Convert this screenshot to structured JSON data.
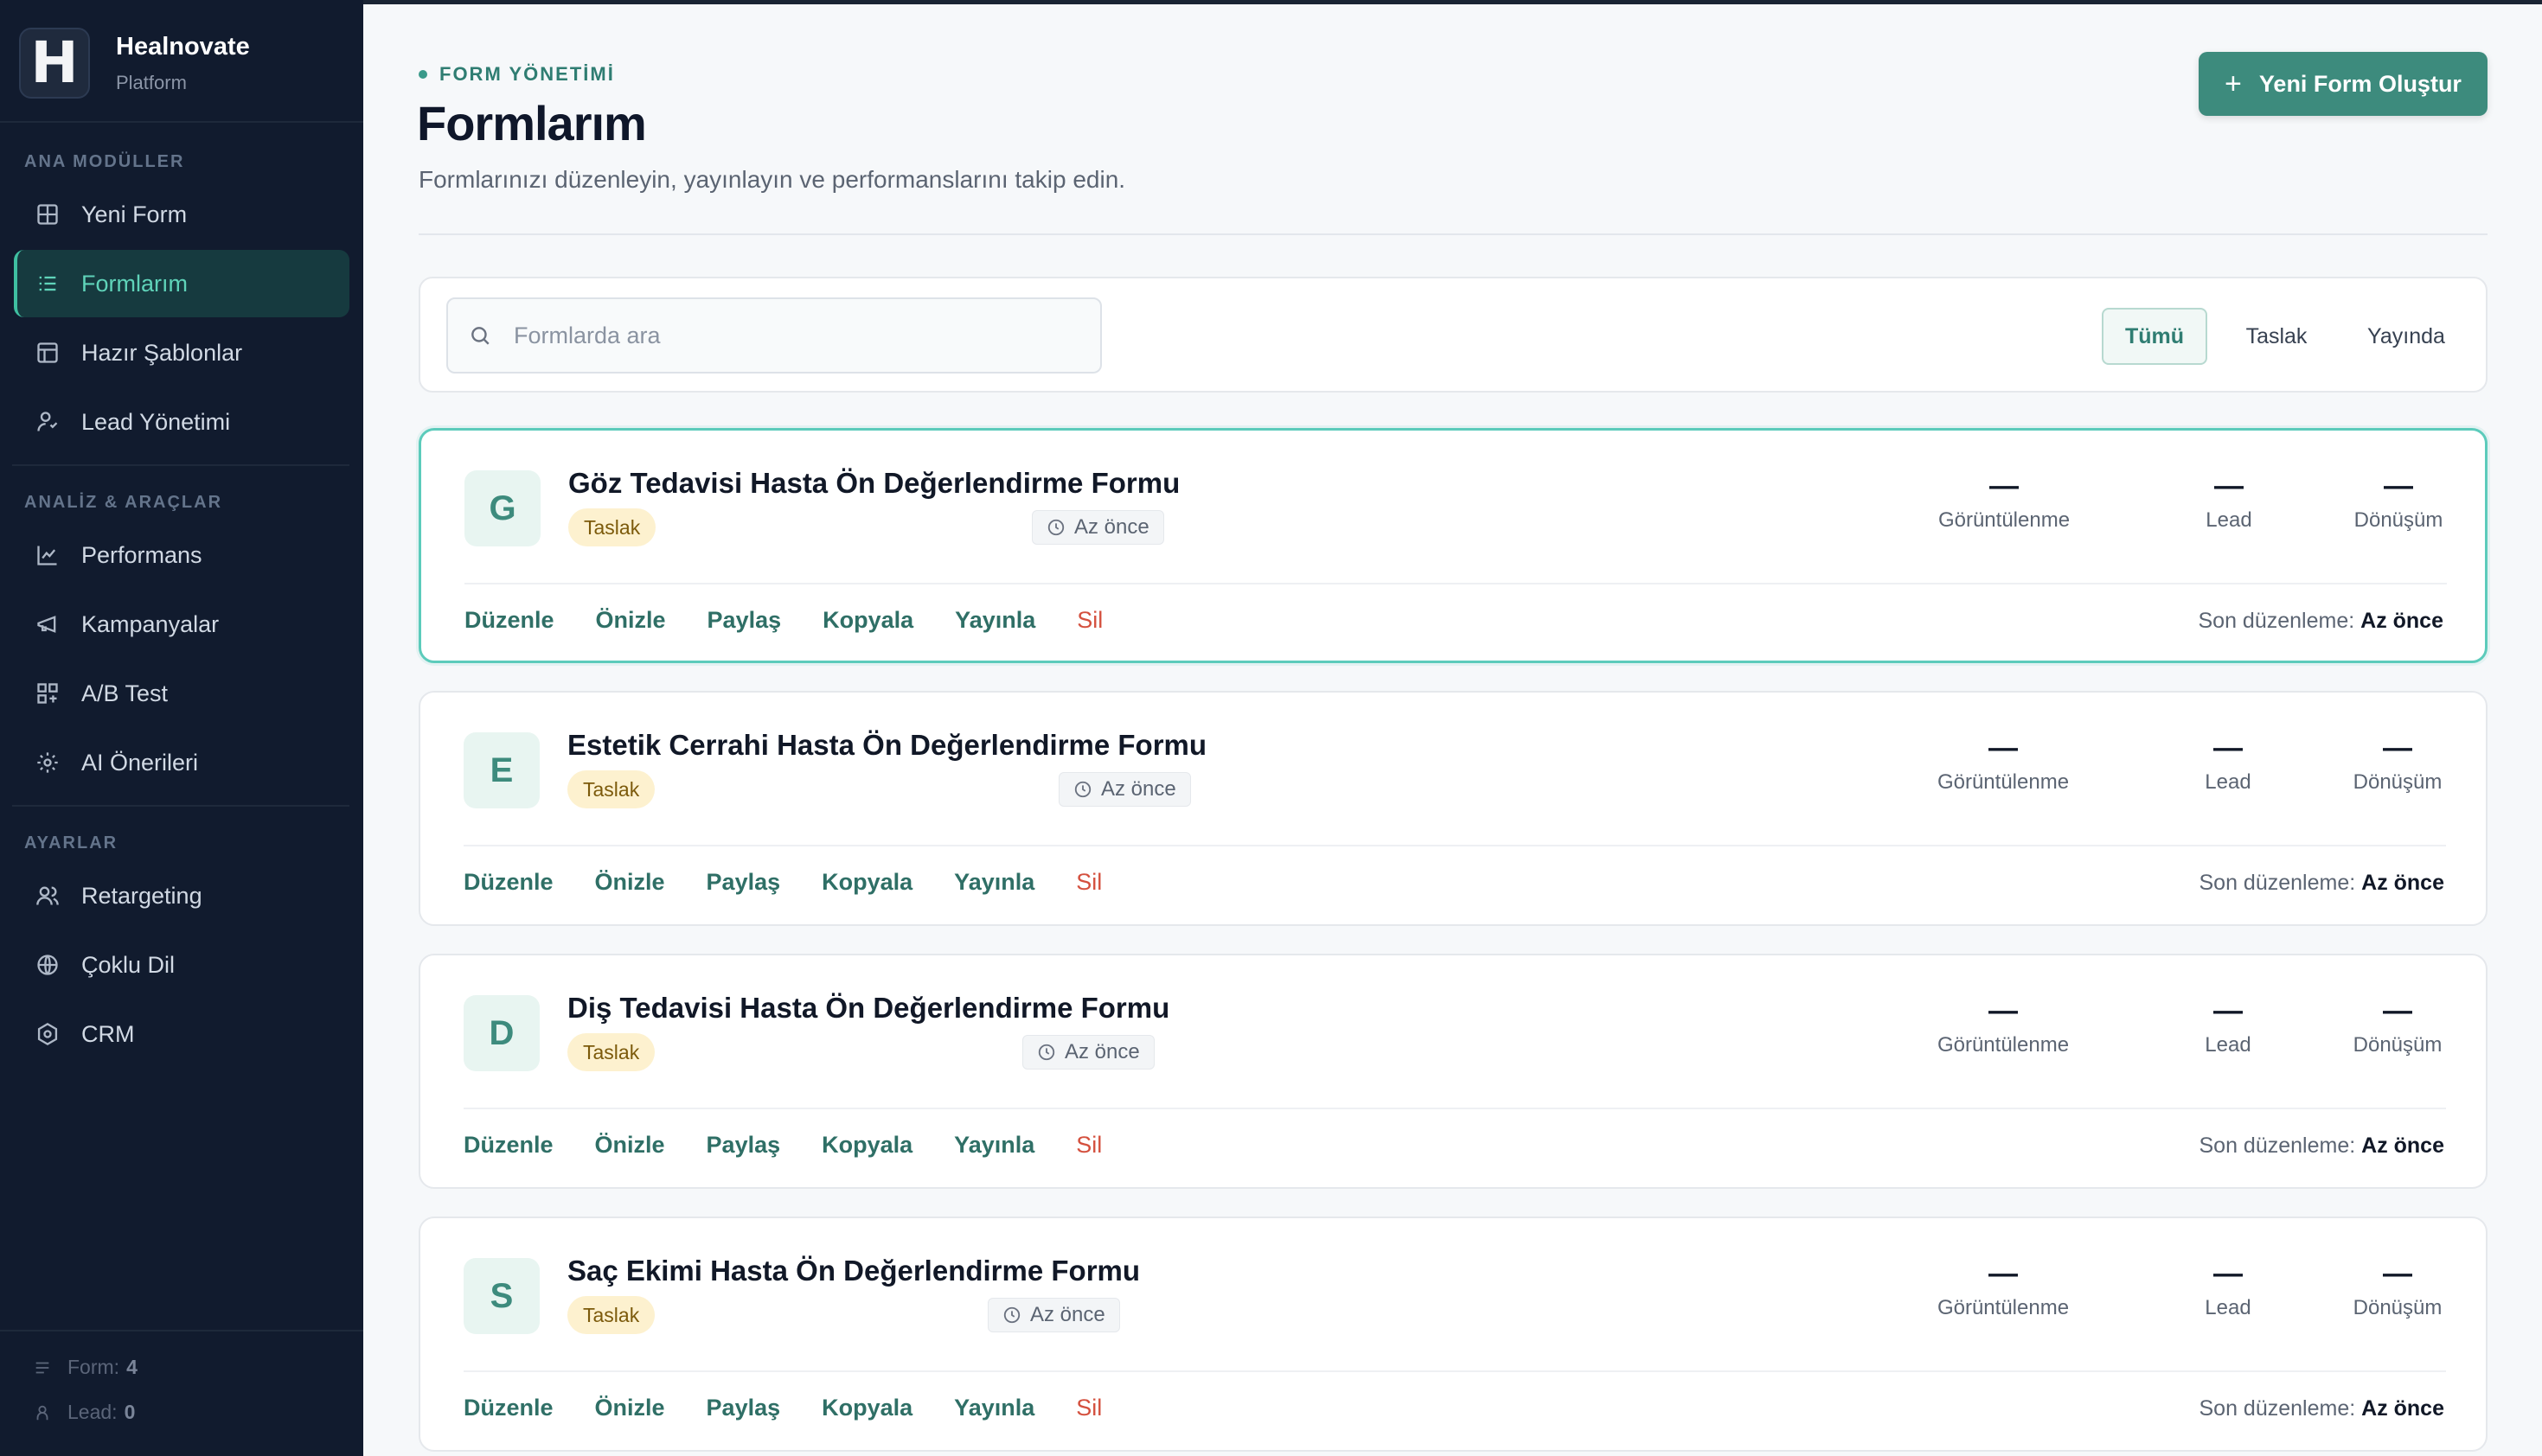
{
  "brand": {
    "name": "Healnovate",
    "subtitle": "Platform",
    "logo_letter": "H"
  },
  "sidebar": {
    "sections": [
      {
        "label": "ANA MODÜLLER",
        "items": [
          {
            "label": "Yeni Form",
            "icon": "grid-icon"
          },
          {
            "label": "Formlarım",
            "icon": "list-icon",
            "active": true
          },
          {
            "label": "Hazır Şablonlar",
            "icon": "template-icon"
          },
          {
            "label": "Lead Yönetimi",
            "icon": "user-icon"
          }
        ]
      },
      {
        "label": "ANALİZ & ARAÇLAR",
        "items": [
          {
            "label": "Performans",
            "icon": "chart-line-icon"
          },
          {
            "label": "Kampanyalar",
            "icon": "megaphone-icon"
          },
          {
            "label": "A/B Test",
            "icon": "ab-test-icon"
          },
          {
            "label": "AI Önerileri",
            "icon": "sparkle-icon"
          }
        ]
      },
      {
        "label": "AYARLAR",
        "items": [
          {
            "label": "Retargeting",
            "icon": "users-icon"
          },
          {
            "label": "Çoklu Dil",
            "icon": "globe-icon"
          },
          {
            "label": "CRM",
            "icon": "settings-hex-icon"
          }
        ]
      }
    ],
    "footer": {
      "form_label": "Form:",
      "form_count": "4",
      "lead_label": "Lead:",
      "lead_count": "0"
    }
  },
  "header": {
    "eyebrow": "FORM YÖNETİMİ",
    "title": "Formlarım",
    "description": "Formlarınızı düzenleyin, yayınlayın ve performanslarını takip edin.",
    "new_button": "Yeni Form Oluştur"
  },
  "filters": {
    "search_placeholder": "Formlarda ara",
    "tabs": [
      {
        "label": "Tümü",
        "active": true
      },
      {
        "label": "Taslak"
      },
      {
        "label": "Yayında"
      }
    ]
  },
  "stat_labels": {
    "views": "Görüntülenme",
    "leads": "Lead",
    "conversion": "Dönüşüm",
    "empty": "—"
  },
  "actions": {
    "edit": "Düzenle",
    "preview": "Önizle",
    "share": "Paylaş",
    "copy": "Kopyala",
    "publish": "Yayınla",
    "delete": "Sil"
  },
  "last_edit_label": "Son düzenleme:",
  "forms": [
    {
      "initial": "G",
      "title": "Göz Tedavisi Hasta Ön Değerlendirme Formu",
      "status": "Taslak",
      "time": "Az önce",
      "views": "—",
      "leads": "—",
      "conversion": "—",
      "last_edit": "Az önce",
      "selected": true
    },
    {
      "initial": "E",
      "title": "Estetik Cerrahi Hasta Ön Değerlendirme Formu",
      "status": "Taslak",
      "time": "Az önce",
      "views": "—",
      "leads": "—",
      "conversion": "—",
      "last_edit": "Az önce"
    },
    {
      "initial": "D",
      "title": "Diş Tedavisi Hasta Ön Değerlendirme Formu",
      "status": "Taslak",
      "time": "Az önce",
      "views": "—",
      "leads": "—",
      "conversion": "—",
      "last_edit": "Az önce"
    },
    {
      "initial": "S",
      "title": "Saç Ekimi Hasta Ön Değerlendirme Formu",
      "status": "Taslak",
      "time": "Az önce",
      "views": "—",
      "leads": "—",
      "conversion": "—",
      "last_edit": "Az önce"
    }
  ],
  "colors": {
    "accent": "#3d8b7d",
    "sidebar_bg": "#111b2e",
    "active_text": "#5fd3b9",
    "danger": "#d4503e",
    "draft_badge": "#fdf1cf"
  }
}
